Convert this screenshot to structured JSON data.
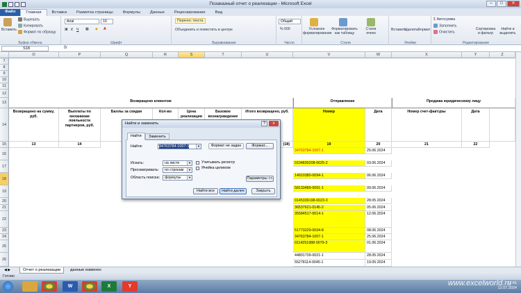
{
  "window": {
    "title": "Позаказный отчет о реализации - Microsoft Excel"
  },
  "ribbon_tabs": [
    "Файл",
    "Главная",
    "Вставка",
    "Разметка страницы",
    "Формулы",
    "Данные",
    "Рецензирование",
    "Вид"
  ],
  "ribbon": {
    "paste": "Вставить",
    "cut": "Вырезать",
    "copy": "Копировать",
    "format_painter": "Формат по образцу",
    "clipboard": "Буфер обмена",
    "font_name": "Arial",
    "font_size": "10",
    "font_group": "Шрифт",
    "wrap_text": "Перенос текста",
    "merge_center": "Объединить и поместить в центре",
    "alignment": "Выравнивание",
    "number_format": "Общий",
    "number": "Число",
    "conditional_formatting": "Условное форматирование",
    "format_as_table": "Форматировать как таблицу",
    "cell_styles": "Стили ячеек",
    "styles": "Стили",
    "insert": "Вставить",
    "delete": "Удалить",
    "format": "Формат",
    "cells": "Ячейки",
    "autosum": "Автосумма",
    "fill": "Заполнить",
    "clear": "Очистить",
    "sort_filter": "Сортировка и фильтр",
    "find_select": "Найти и выделить",
    "editing": "Редактирование"
  },
  "formula_bar": {
    "name_box": "S18",
    "fx": "fx"
  },
  "columns": [
    "O",
    "P",
    "Q",
    "R",
    "S",
    "T",
    "U",
    "V",
    "W",
    "X",
    "Y",
    "Z"
  ],
  "rows": [
    "7",
    "8",
    "9",
    "10",
    "11",
    "12",
    "13",
    "14",
    "15",
    "16",
    "17",
    "18",
    "19",
    "20",
    "21",
    "22",
    "23",
    "24",
    "25",
    "26"
  ],
  "sheet": {
    "group_returned": "Возвращено клиентом",
    "group_shipment": "Отправление",
    "group_sale": "Продажа юридическому лицу",
    "h_returned_sum": "Возвращено на сумму, руб.",
    "h_payouts": "Выплаты по механикам лояльности партнеров, руб.",
    "h_points": "Баллы за скидки",
    "h_qty": "Кол-во",
    "h_price": "Цена реализации",
    "h_base": "Базовое вознаграждение",
    "h_total_returned": "Итого возвращено, руб.",
    "h_number": "Номер",
    "h_date": "Дата",
    "h_invoice": "Номер счет-фактуры",
    "h_date2": "Дата",
    "n13": "13",
    "n14": "14",
    "n18": "(18)",
    "n19": "19",
    "n20": "20",
    "n21": "21",
    "n22": "22"
  },
  "shipments": [
    {
      "number": "34763784-1007-1",
      "date": "25.06.2024",
      "highlight": true
    },
    {
      "number": "0104830208-0025-2",
      "date": "03.06.2024"
    },
    {
      "number": "14910380-0094-1",
      "date": "06.06.2024"
    },
    {
      "number": "58133489-0091-1",
      "date": "09.06.2024"
    },
    {
      "number": "0145339198-0023-3",
      "date": "28.05.2024"
    },
    {
      "number": "36537621-0145-2",
      "date": "05.06.2024"
    },
    {
      "number": "35584517-0014-1",
      "date": "12.06.2024"
    },
    {
      "number": "51773229-0034-8",
      "date": "08.06.2024"
    },
    {
      "number": "34763784-1007-1",
      "date": "25.06.2024"
    },
    {
      "number": "0114251988-0079-3",
      "date": "01.06.2024"
    },
    {
      "number": "44801739-0021-1",
      "date": "28.05.2024"
    },
    {
      "number": "55278114-0045-1",
      "date": "19.05.2024"
    }
  ],
  "dialog": {
    "title": "Найти и заменить",
    "help": "?",
    "close": "x",
    "tab_find": "Найти",
    "tab_replace": "Заменить",
    "find_label": "Найти:",
    "find_value": "34763784-1007-1",
    "format_not_set": "Формат не задан",
    "format_button": "Формат...",
    "within_label": "Искать:",
    "within_value": "на листе",
    "search_label": "Просматривать:",
    "search_value": "по строкам",
    "lookin_label": "Область поиска:",
    "lookin_value": "формулы",
    "match_case": "Учитывать регистр",
    "entire_cell": "Ячейка целиком",
    "options_button": "Параметры <<",
    "find_all": "Найти все",
    "find_next": "Найти далее",
    "close_button": "Закрыть"
  },
  "sheet_tabs": [
    "Отчет о реализации",
    "данные изменен"
  ],
  "status": "Готово",
  "taskbar": {
    "time": "11:41",
    "date": "12.07.2024",
    "watermark": "www.excelworld.ru"
  },
  "colors": {
    "highlight": "#ffff00",
    "found_text": "#e0141e",
    "file_tab": "#2a5ea8"
  }
}
